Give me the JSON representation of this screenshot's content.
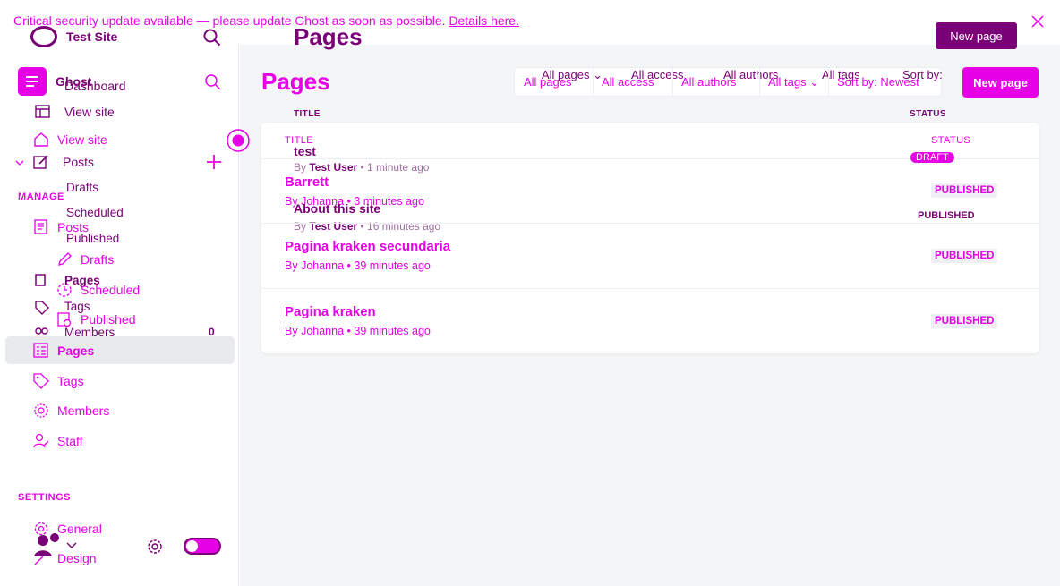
{
  "banner": {
    "message": "Critical security update available — please update Ghost as soon as possible.",
    "link": "Details here."
  },
  "ghost_layer": {
    "site_name": "Test Site",
    "page_title": "Pages",
    "new_page": "New page",
    "nav": {
      "ghost": "Ghost",
      "dashboard": "Dashboard",
      "view_site": "View site",
      "posts": "Posts",
      "drafts": "Drafts",
      "scheduled": "Scheduled",
      "published": "Published",
      "pages": "Pages",
      "tags": "Tags",
      "members": "Members",
      "members_count": "0"
    },
    "filters": {
      "all_pages": "All pages",
      "all_access": "All access",
      "all_authors": "All authors",
      "all_tags": "All tags",
      "sort": "Sort by: Newest"
    },
    "columns": {
      "title": "TITLE",
      "status": "STATUS"
    },
    "rows": [
      {
        "title": "test",
        "meta_by": "By",
        "author": "Test User",
        "time": "1 minute ago",
        "status": "DRAFT"
      },
      {
        "title": "About this site",
        "meta_by": "By",
        "author": "Test User",
        "time": "16 minutes ago",
        "status": "PUBLISHED"
      }
    ]
  },
  "sidebar": {
    "view_site": "View site",
    "posts": "Posts",
    "manage_label": "MANAGE",
    "manage_posts": "Posts",
    "drafts": "Drafts",
    "scheduled": "Scheduled",
    "published": "Published",
    "pages": "Pages",
    "tags": "Tags",
    "members": "Members",
    "staff": "Staff",
    "settings_label": "SETTINGS",
    "general": "General",
    "design": "Design"
  },
  "main": {
    "title": "Pages",
    "new_page": "New page",
    "filters": {
      "all_pages": "All pages",
      "all_access": "All access",
      "all_authors": "All authors",
      "all_tags": "All tags",
      "sort": "Sort by: Newest"
    },
    "columns": {
      "title": "TITLE",
      "status": "STATUS"
    },
    "rows": [
      {
        "title": "Barrett",
        "by": "By",
        "author": "Johanna",
        "time": "3 minutes ago",
        "status": "PUBLISHED"
      },
      {
        "title": "Pagina kraken secundaria",
        "by": "By",
        "author": "Johanna",
        "time": "39 minutes ago",
        "status": "PUBLISHED"
      },
      {
        "title": "Pagina kraken",
        "by": "By",
        "author": "Johanna",
        "time": "39 minutes ago",
        "status": "PUBLISHED"
      }
    ]
  },
  "colors": {
    "accent": "#e600e6",
    "dark_accent": "#7a0077",
    "bg": "#f4f5f7"
  }
}
